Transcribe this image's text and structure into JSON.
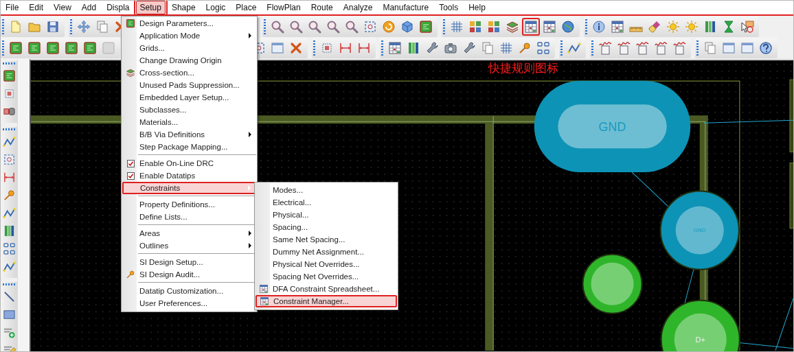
{
  "menu_bar": [
    {
      "label": "File",
      "selected": false
    },
    {
      "label": "Edit",
      "selected": false
    },
    {
      "label": "View",
      "selected": false
    },
    {
      "label": "Add",
      "selected": false
    },
    {
      "label": "Displa",
      "selected": false
    },
    {
      "label": "Setup",
      "selected": true
    },
    {
      "label": "Shape",
      "selected": false
    },
    {
      "label": "Logic",
      "selected": false
    },
    {
      "label": "Place",
      "selected": false
    },
    {
      "label": "FlowPlan",
      "selected": false
    },
    {
      "label": "Route",
      "selected": false
    },
    {
      "label": "Analyze",
      "selected": false
    },
    {
      "label": "Manufacture",
      "selected": false
    },
    {
      "label": "Tools",
      "selected": false
    },
    {
      "label": "Help",
      "selected": false
    }
  ],
  "toolbar_rows": [
    [
      [
        {
          "kind": "doc",
          "annotated": false
        },
        {
          "kind": "folder",
          "annotated": false
        },
        {
          "kind": "save",
          "annotated": false
        }
      ],
      [
        {
          "kind": "move",
          "annotated": false
        },
        {
          "kind": "copy",
          "annotated": false
        },
        {
          "kind": "delete",
          "annotated": false
        }
      ],
      [
        {
          "kind": "magnifier",
          "annotated": false
        },
        {
          "kind": "magnifier",
          "annotated": false
        },
        {
          "kind": "magnifier",
          "annotated": false
        },
        {
          "kind": "magnifier",
          "annotated": false
        },
        {
          "kind": "magnifier",
          "annotated": false
        },
        {
          "kind": "frame",
          "annotated": false
        },
        {
          "kind": "refresh",
          "annotated": false
        },
        {
          "kind": "cube",
          "annotated": false
        },
        {
          "kind": "board",
          "annotated": false
        }
      ],
      [
        {
          "kind": "grid",
          "annotated": false
        },
        {
          "kind": "tiles",
          "annotated": false
        },
        {
          "kind": "tiles",
          "annotated": false
        },
        {
          "kind": "layers",
          "annotated": false
        },
        {
          "kind": "table",
          "annotated": true
        },
        {
          "kind": "table",
          "annotated": false
        },
        {
          "kind": "globe",
          "annotated": false
        }
      ],
      [
        {
          "kind": "info",
          "annotated": false
        },
        {
          "kind": "table",
          "annotated": false
        },
        {
          "kind": "ruler",
          "annotated": false
        },
        {
          "kind": "brush",
          "annotated": false
        },
        {
          "kind": "sun",
          "annotated": false
        },
        {
          "kind": "sun",
          "annotated": false
        },
        {
          "kind": "bars",
          "annotated": false
        },
        {
          "kind": "hourglass",
          "annotated": false
        },
        {
          "kind": "cursor",
          "annotated": false
        }
      ]
    ],
    [
      [
        {
          "kind": "board",
          "annotated": false
        },
        {
          "kind": "board",
          "annotated": false
        },
        {
          "kind": "board",
          "annotated": false
        },
        {
          "kind": "board",
          "annotated": false
        },
        {
          "kind": "board",
          "annotated": false
        },
        {
          "kind": "blank",
          "annotated": false
        }
      ],
      [
        {
          "kind": "frame",
          "annotated": false
        },
        {
          "kind": "window",
          "annotated": false
        },
        {
          "kind": "delete",
          "annotated": false
        }
      ],
      [
        {
          "kind": "chip",
          "annotated": false
        },
        {
          "kind": "dimension",
          "annotated": false
        },
        {
          "kind": "dimension",
          "annotated": false
        }
      ],
      [
        {
          "kind": "table",
          "annotated": false
        },
        {
          "kind": "bars",
          "annotated": false
        },
        {
          "kind": "wrench",
          "annotated": false
        },
        {
          "kind": "camera",
          "annotated": false
        },
        {
          "kind": "wrench",
          "annotated": false
        },
        {
          "kind": "copy",
          "annotated": false
        },
        {
          "kind": "grid",
          "annotated": false
        },
        {
          "kind": "probe",
          "annotated": false
        },
        {
          "kind": "pins",
          "annotated": false
        }
      ],
      [
        {
          "kind": "route",
          "annotated": false
        }
      ],
      [
        {
          "kind": "wave",
          "annotated": false
        },
        {
          "kind": "wave",
          "annotated": false
        },
        {
          "kind": "wave",
          "annotated": false
        },
        {
          "kind": "wave",
          "annotated": false
        },
        {
          "kind": "wave",
          "annotated": false
        }
      ],
      [
        {
          "kind": "copy",
          "annotated": false
        },
        {
          "kind": "window",
          "annotated": false
        },
        {
          "kind": "window",
          "annotated": false
        },
        {
          "kind": "help",
          "annotated": false
        }
      ]
    ]
  ],
  "side_toolbar": [
    [
      {
        "kind": "board"
      },
      {
        "kind": "chip"
      },
      {
        "kind": "connector"
      }
    ],
    [
      {
        "kind": "route"
      },
      {
        "kind": "frame"
      },
      {
        "kind": "dimension"
      },
      {
        "kind": "probe"
      },
      {
        "kind": "route"
      },
      {
        "kind": "bars"
      },
      {
        "kind": "pins"
      },
      {
        "kind": "route"
      }
    ],
    [
      {
        "kind": "line"
      },
      {
        "kind": "rect"
      },
      {
        "kind": "text-add"
      },
      {
        "kind": "text-edit"
      }
    ]
  ],
  "setup_menu": [
    {
      "kind": "icon",
      "label": "Design Parameters...",
      "submenu": false,
      "selected": false,
      "annotated": false
    },
    {
      "kind": "item",
      "label": "Application Mode",
      "submenu": true,
      "selected": false,
      "annotated": false
    },
    {
      "kind": "item",
      "label": "Grids...",
      "submenu": false,
      "selected": false,
      "annotated": false
    },
    {
      "kind": "item",
      "label": "Change Drawing Origin",
      "submenu": false,
      "selected": false,
      "annotated": false
    },
    {
      "kind": "icon",
      "label": "Cross-section...",
      "submenu": false,
      "selected": false,
      "annotated": false
    },
    {
      "kind": "item",
      "label": "Unused Pads Suppression...",
      "submenu": false,
      "selected": false,
      "annotated": false
    },
    {
      "kind": "item",
      "label": "Embedded Layer Setup...",
      "submenu": false,
      "selected": false,
      "annotated": false
    },
    {
      "kind": "item",
      "label": "Subclasses...",
      "submenu": false,
      "selected": false,
      "annotated": false
    },
    {
      "kind": "item",
      "label": "Materials...",
      "submenu": false,
      "selected": false,
      "annotated": false
    },
    {
      "kind": "item",
      "label": "B/B Via Definitions",
      "submenu": true,
      "selected": false,
      "annotated": false
    },
    {
      "kind": "item",
      "label": "Step Package Mapping...",
      "submenu": false,
      "selected": false,
      "annotated": false
    },
    {
      "kind": "separator"
    },
    {
      "kind": "check",
      "label": "Enable On-Line DRC",
      "checked": true,
      "submenu": false,
      "selected": false,
      "annotated": false
    },
    {
      "kind": "check",
      "label": "Enable Datatips",
      "checked": true,
      "submenu": false,
      "selected": false,
      "annotated": false
    },
    {
      "kind": "item",
      "label": "Constraints",
      "submenu": true,
      "selected": true,
      "annotated": true
    },
    {
      "kind": "separator"
    },
    {
      "kind": "item",
      "label": "Property Definitions...",
      "submenu": false,
      "selected": false,
      "annotated": false
    },
    {
      "kind": "item",
      "label": "Define Lists...",
      "submenu": false,
      "selected": false,
      "annotated": false
    },
    {
      "kind": "separator"
    },
    {
      "kind": "item",
      "label": "Areas",
      "submenu": true,
      "selected": false,
      "annotated": false
    },
    {
      "kind": "item",
      "label": "Outlines",
      "submenu": true,
      "selected": false,
      "annotated": false
    },
    {
      "kind": "separator"
    },
    {
      "kind": "item",
      "label": "SI Design Setup...",
      "submenu": false,
      "selected": false,
      "annotated": false
    },
    {
      "kind": "icon",
      "label": "SI Design Audit...",
      "submenu": false,
      "selected": false,
      "annotated": false
    },
    {
      "kind": "separator"
    },
    {
      "kind": "item",
      "label": "Datatip Customization...",
      "submenu": false,
      "selected": false,
      "annotated": false
    },
    {
      "kind": "item",
      "label": "User Preferences...",
      "submenu": false,
      "selected": false,
      "annotated": false
    }
  ],
  "constraints_submenu": [
    {
      "kind": "item",
      "label": "Modes...",
      "submenu": false,
      "selected": false,
      "annotated": false
    },
    {
      "kind": "item",
      "label": "Electrical...",
      "submenu": false,
      "selected": false,
      "annotated": false
    },
    {
      "kind": "item",
      "label": "Physical...",
      "submenu": false,
      "selected": false,
      "annotated": false
    },
    {
      "kind": "item",
      "label": "Spacing...",
      "submenu": false,
      "selected": false,
      "annotated": false
    },
    {
      "kind": "item",
      "label": "Same Net Spacing...",
      "submenu": false,
      "selected": false,
      "annotated": false
    },
    {
      "kind": "item",
      "label": "Dummy Net Assignment...",
      "submenu": false,
      "selected": false,
      "annotated": false
    },
    {
      "kind": "item",
      "label": "Physical Net Overrides...",
      "submenu": false,
      "selected": false,
      "annotated": false
    },
    {
      "kind": "item",
      "label": "Spacing Net Overrides...",
      "submenu": false,
      "selected": false,
      "annotated": false
    },
    {
      "kind": "icon",
      "label": "DFA Constraint Spreadsheet...",
      "submenu": false,
      "selected": false,
      "annotated": false
    },
    {
      "kind": "icon",
      "label": "Constraint Manager...",
      "submenu": false,
      "selected": true,
      "annotated": true
    }
  ],
  "canvas": {
    "annotation_label": "快捷规则图标",
    "pads": [
      {
        "label": "GND",
        "color": "#0d93b5"
      },
      {
        "label": "GND",
        "color": "#0d93b5"
      },
      {
        "color": "#2fb52a"
      },
      {
        "label": "D+",
        "color": "#2fb52a"
      }
    ]
  }
}
